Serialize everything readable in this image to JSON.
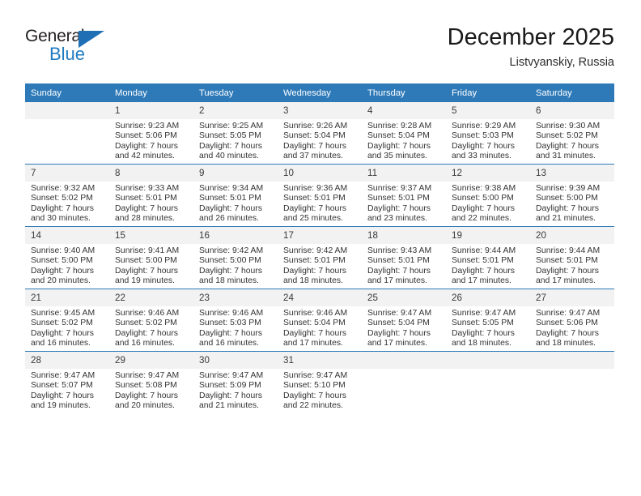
{
  "brand": {
    "name_top": "General",
    "name_bottom": "Blue",
    "accent_color": "#1f7bc1",
    "triangle_color": "#1f6fb5"
  },
  "header": {
    "title": "December 2025",
    "subtitle": "Listvyanskiy, Russia",
    "header_bg": "#2e7ab8",
    "daynum_bg": "#f2f2f2"
  },
  "weekday_headers": [
    "Sunday",
    "Monday",
    "Tuesday",
    "Wednesday",
    "Thursday",
    "Friday",
    "Saturday"
  ],
  "weeks": [
    [
      {
        "day": "",
        "empty": true,
        "sunrise": "",
        "sunset": "",
        "daylight_1": "",
        "daylight_2": ""
      },
      {
        "day": "1",
        "sunrise": "Sunrise: 9:23 AM",
        "sunset": "Sunset: 5:06 PM",
        "daylight_1": "Daylight: 7 hours",
        "daylight_2": "and 42 minutes."
      },
      {
        "day": "2",
        "sunrise": "Sunrise: 9:25 AM",
        "sunset": "Sunset: 5:05 PM",
        "daylight_1": "Daylight: 7 hours",
        "daylight_2": "and 40 minutes."
      },
      {
        "day": "3",
        "sunrise": "Sunrise: 9:26 AM",
        "sunset": "Sunset: 5:04 PM",
        "daylight_1": "Daylight: 7 hours",
        "daylight_2": "and 37 minutes."
      },
      {
        "day": "4",
        "sunrise": "Sunrise: 9:28 AM",
        "sunset": "Sunset: 5:04 PM",
        "daylight_1": "Daylight: 7 hours",
        "daylight_2": "and 35 minutes."
      },
      {
        "day": "5",
        "sunrise": "Sunrise: 9:29 AM",
        "sunset": "Sunset: 5:03 PM",
        "daylight_1": "Daylight: 7 hours",
        "daylight_2": "and 33 minutes."
      },
      {
        "day": "6",
        "sunrise": "Sunrise: 9:30 AM",
        "sunset": "Sunset: 5:02 PM",
        "daylight_1": "Daylight: 7 hours",
        "daylight_2": "and 31 minutes."
      }
    ],
    [
      {
        "day": "7",
        "sunrise": "Sunrise: 9:32 AM",
        "sunset": "Sunset: 5:02 PM",
        "daylight_1": "Daylight: 7 hours",
        "daylight_2": "and 30 minutes."
      },
      {
        "day": "8",
        "sunrise": "Sunrise: 9:33 AM",
        "sunset": "Sunset: 5:01 PM",
        "daylight_1": "Daylight: 7 hours",
        "daylight_2": "and 28 minutes."
      },
      {
        "day": "9",
        "sunrise": "Sunrise: 9:34 AM",
        "sunset": "Sunset: 5:01 PM",
        "daylight_1": "Daylight: 7 hours",
        "daylight_2": "and 26 minutes."
      },
      {
        "day": "10",
        "sunrise": "Sunrise: 9:36 AM",
        "sunset": "Sunset: 5:01 PM",
        "daylight_1": "Daylight: 7 hours",
        "daylight_2": "and 25 minutes."
      },
      {
        "day": "11",
        "sunrise": "Sunrise: 9:37 AM",
        "sunset": "Sunset: 5:01 PM",
        "daylight_1": "Daylight: 7 hours",
        "daylight_2": "and 23 minutes."
      },
      {
        "day": "12",
        "sunrise": "Sunrise: 9:38 AM",
        "sunset": "Sunset: 5:00 PM",
        "daylight_1": "Daylight: 7 hours",
        "daylight_2": "and 22 minutes."
      },
      {
        "day": "13",
        "sunrise": "Sunrise: 9:39 AM",
        "sunset": "Sunset: 5:00 PM",
        "daylight_1": "Daylight: 7 hours",
        "daylight_2": "and 21 minutes."
      }
    ],
    [
      {
        "day": "14",
        "sunrise": "Sunrise: 9:40 AM",
        "sunset": "Sunset: 5:00 PM",
        "daylight_1": "Daylight: 7 hours",
        "daylight_2": "and 20 minutes."
      },
      {
        "day": "15",
        "sunrise": "Sunrise: 9:41 AM",
        "sunset": "Sunset: 5:00 PM",
        "daylight_1": "Daylight: 7 hours",
        "daylight_2": "and 19 minutes."
      },
      {
        "day": "16",
        "sunrise": "Sunrise: 9:42 AM",
        "sunset": "Sunset: 5:00 PM",
        "daylight_1": "Daylight: 7 hours",
        "daylight_2": "and 18 minutes."
      },
      {
        "day": "17",
        "sunrise": "Sunrise: 9:42 AM",
        "sunset": "Sunset: 5:01 PM",
        "daylight_1": "Daylight: 7 hours",
        "daylight_2": "and 18 minutes."
      },
      {
        "day": "18",
        "sunrise": "Sunrise: 9:43 AM",
        "sunset": "Sunset: 5:01 PM",
        "daylight_1": "Daylight: 7 hours",
        "daylight_2": "and 17 minutes."
      },
      {
        "day": "19",
        "sunrise": "Sunrise: 9:44 AM",
        "sunset": "Sunset: 5:01 PM",
        "daylight_1": "Daylight: 7 hours",
        "daylight_2": "and 17 minutes."
      },
      {
        "day": "20",
        "sunrise": "Sunrise: 9:44 AM",
        "sunset": "Sunset: 5:01 PM",
        "daylight_1": "Daylight: 7 hours",
        "daylight_2": "and 17 minutes."
      }
    ],
    [
      {
        "day": "21",
        "sunrise": "Sunrise: 9:45 AM",
        "sunset": "Sunset: 5:02 PM",
        "daylight_1": "Daylight: 7 hours",
        "daylight_2": "and 16 minutes."
      },
      {
        "day": "22",
        "sunrise": "Sunrise: 9:46 AM",
        "sunset": "Sunset: 5:02 PM",
        "daylight_1": "Daylight: 7 hours",
        "daylight_2": "and 16 minutes."
      },
      {
        "day": "23",
        "sunrise": "Sunrise: 9:46 AM",
        "sunset": "Sunset: 5:03 PM",
        "daylight_1": "Daylight: 7 hours",
        "daylight_2": "and 16 minutes."
      },
      {
        "day": "24",
        "sunrise": "Sunrise: 9:46 AM",
        "sunset": "Sunset: 5:04 PM",
        "daylight_1": "Daylight: 7 hours",
        "daylight_2": "and 17 minutes."
      },
      {
        "day": "25",
        "sunrise": "Sunrise: 9:47 AM",
        "sunset": "Sunset: 5:04 PM",
        "daylight_1": "Daylight: 7 hours",
        "daylight_2": "and 17 minutes."
      },
      {
        "day": "26",
        "sunrise": "Sunrise: 9:47 AM",
        "sunset": "Sunset: 5:05 PM",
        "daylight_1": "Daylight: 7 hours",
        "daylight_2": "and 18 minutes."
      },
      {
        "day": "27",
        "sunrise": "Sunrise: 9:47 AM",
        "sunset": "Sunset: 5:06 PM",
        "daylight_1": "Daylight: 7 hours",
        "daylight_2": "and 18 minutes."
      }
    ],
    [
      {
        "day": "28",
        "sunrise": "Sunrise: 9:47 AM",
        "sunset": "Sunset: 5:07 PM",
        "daylight_1": "Daylight: 7 hours",
        "daylight_2": "and 19 minutes."
      },
      {
        "day": "29",
        "sunrise": "Sunrise: 9:47 AM",
        "sunset": "Sunset: 5:08 PM",
        "daylight_1": "Daylight: 7 hours",
        "daylight_2": "and 20 minutes."
      },
      {
        "day": "30",
        "sunrise": "Sunrise: 9:47 AM",
        "sunset": "Sunset: 5:09 PM",
        "daylight_1": "Daylight: 7 hours",
        "daylight_2": "and 21 minutes."
      },
      {
        "day": "31",
        "sunrise": "Sunrise: 9:47 AM",
        "sunset": "Sunset: 5:10 PM",
        "daylight_1": "Daylight: 7 hours",
        "daylight_2": "and 22 minutes."
      },
      {
        "day": "",
        "empty": true,
        "sunrise": "",
        "sunset": "",
        "daylight_1": "",
        "daylight_2": ""
      },
      {
        "day": "",
        "empty": true,
        "sunrise": "",
        "sunset": "",
        "daylight_1": "",
        "daylight_2": ""
      },
      {
        "day": "",
        "empty": true,
        "sunrise": "",
        "sunset": "",
        "daylight_1": "",
        "daylight_2": ""
      }
    ]
  ]
}
